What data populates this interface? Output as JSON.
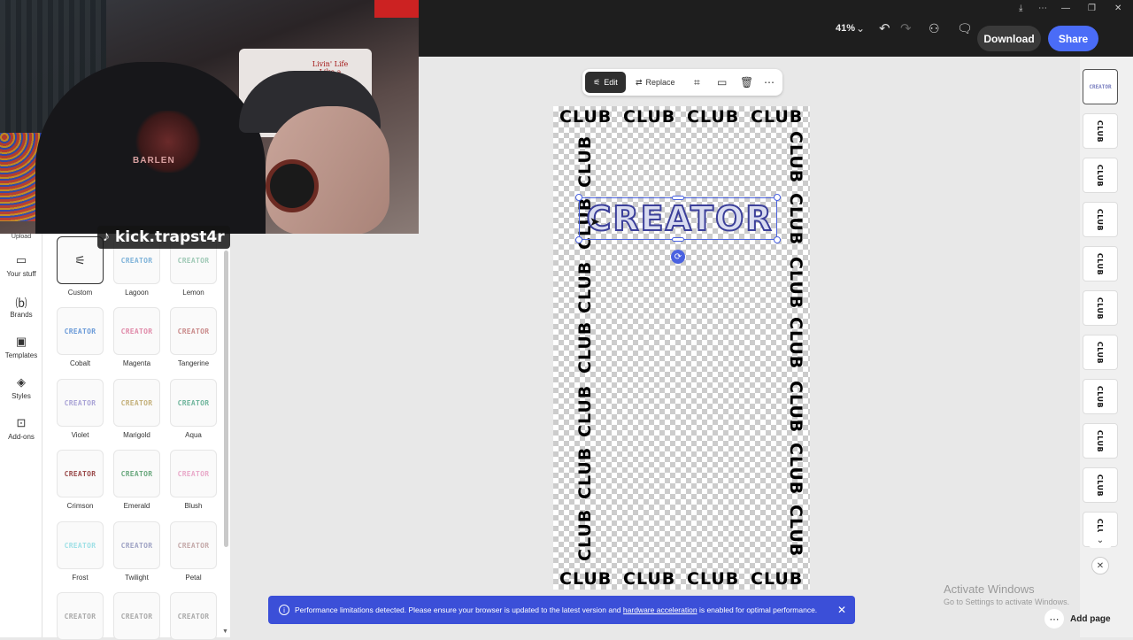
{
  "topbar": {
    "zoom": "41%",
    "download_label": "Download",
    "share_label": "Share"
  },
  "overlay": {
    "channel_tag": "kick.trapst4r",
    "shirt_text": "Livin' Life Like a Donkey!",
    "hoodie_text": "BARLEN"
  },
  "left_rail": {
    "upload_label": "Upload",
    "items": [
      {
        "icon": "folder-icon",
        "label": "Your stuff"
      },
      {
        "icon": "brands-icon",
        "label": "Brands"
      },
      {
        "icon": "templates-icon",
        "label": "Templates"
      },
      {
        "icon": "styles-icon",
        "label": "Styles"
      },
      {
        "icon": "addons-icon",
        "label": "Add-ons"
      }
    ]
  },
  "styles_panel": {
    "swatch_text": "CREATOR",
    "swatches": [
      {
        "name": "Custom",
        "color": "#333333"
      },
      {
        "name": "Lagoon",
        "color": "#7fb3d9"
      },
      {
        "name": "Lemon",
        "color": "#9fc9b6"
      },
      {
        "name": "Cobalt",
        "color": "#6a9ad8"
      },
      {
        "name": "Magenta",
        "color": "#e08aa9"
      },
      {
        "name": "Tangerine",
        "color": "#c98a8a"
      },
      {
        "name": "Violet",
        "color": "#a9a3d6"
      },
      {
        "name": "Marigold",
        "color": "#c4b07a"
      },
      {
        "name": "Aqua",
        "color": "#6fb59c"
      },
      {
        "name": "Crimson",
        "color": "#9a4a4a"
      },
      {
        "name": "Emerald",
        "color": "#6aa87e"
      },
      {
        "name": "Blush",
        "color": "#e9a9c9"
      },
      {
        "name": "Frost",
        "color": "#9fe0e6"
      },
      {
        "name": "Twilight",
        "color": "#9fa3c4"
      },
      {
        "name": "Petal",
        "color": "#c4a9a9"
      },
      {
        "name": "",
        "color": "#aaaaaa"
      },
      {
        "name": "",
        "color": "#aaaaaa"
      },
      {
        "name": "",
        "color": "#aaaaaa"
      }
    ]
  },
  "context_toolbar": {
    "edit_label": "Edit",
    "replace_label": "Replace"
  },
  "canvas": {
    "border_word": "CLUB",
    "headline": "CREATOR"
  },
  "thumbnails": {
    "first_text": "CREATOR",
    "other_text": "CLUB",
    "count": 11
  },
  "toast": {
    "text_before": "Performance limitations detected. Please ensure your browser is updated to the latest version and",
    "link": "hardware acceleration",
    "text_after": "is enabled for optimal performance."
  },
  "watermark": {
    "title": "Activate Windows",
    "subtitle": "Go to Settings to activate Windows."
  },
  "bottom": {
    "add_page_label": "Add page"
  }
}
